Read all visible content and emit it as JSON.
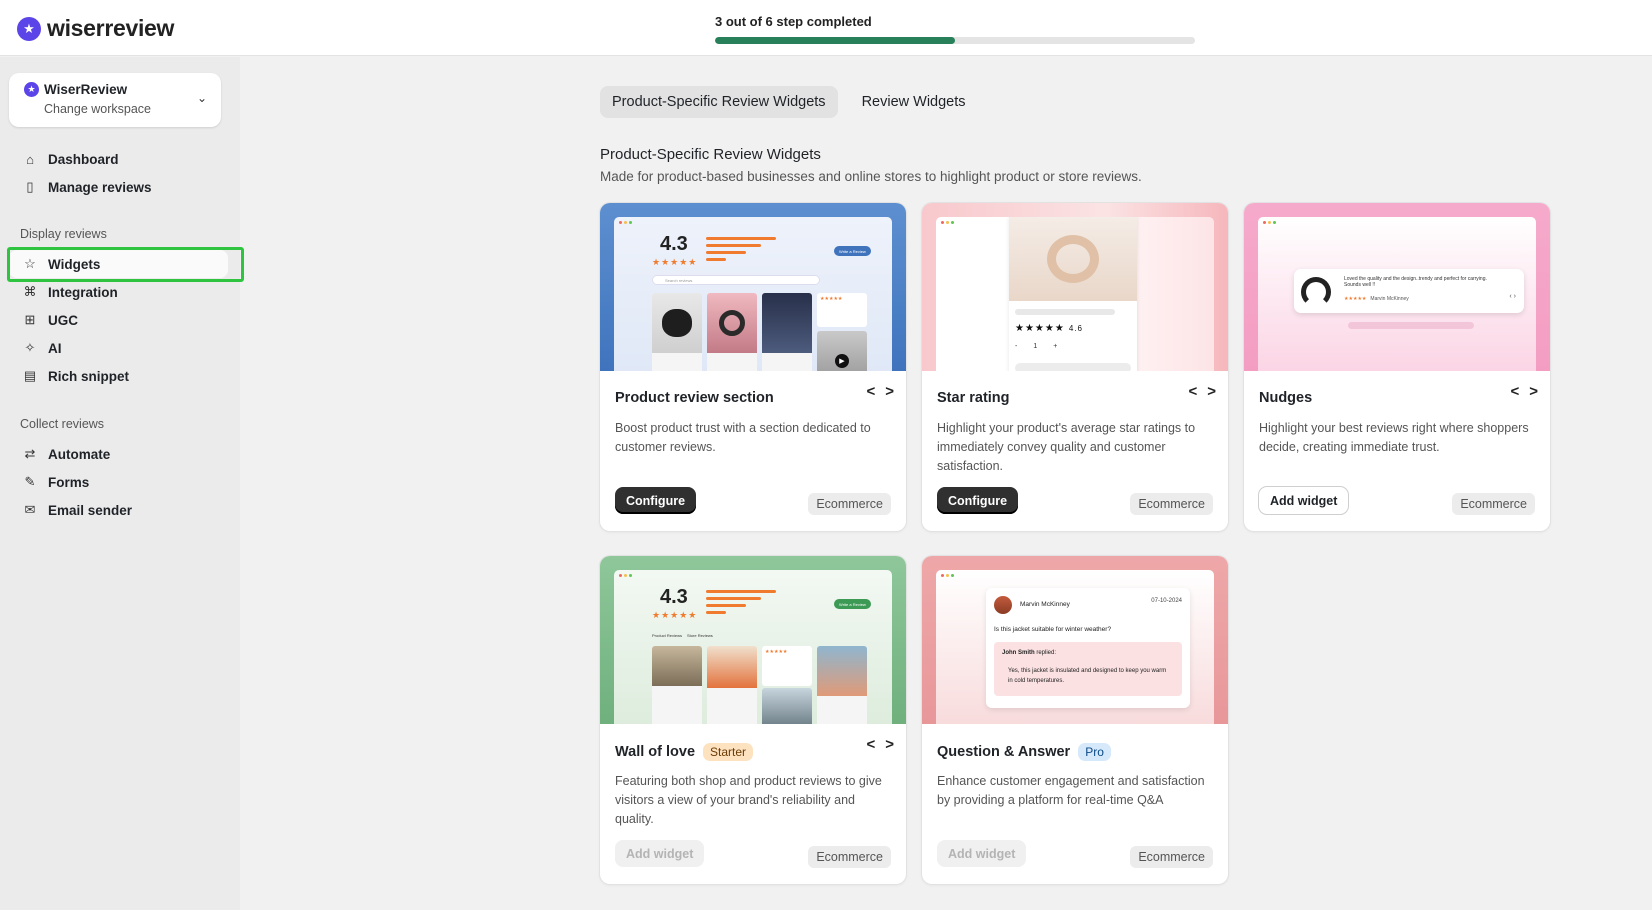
{
  "brand": {
    "name": "wiserreview"
  },
  "progress": {
    "label": "3 out of 6 step completed",
    "fraction": 0.5
  },
  "workspace": {
    "name": "WiserReview",
    "action": "Change workspace"
  },
  "nav": {
    "main": [
      {
        "label": "Dashboard",
        "icon": "home-icon"
      },
      {
        "label": "Manage reviews",
        "icon": "document-icon"
      }
    ],
    "display_heading": "Display reviews",
    "display": [
      {
        "label": "Widgets",
        "icon": "star-icon",
        "active": true
      },
      {
        "label": "Integration",
        "icon": "grid-icon"
      },
      {
        "label": "UGC",
        "icon": "ugc-icon"
      },
      {
        "label": "AI",
        "icon": "sparkle-icon"
      },
      {
        "label": "Rich snippet",
        "icon": "snippet-icon"
      }
    ],
    "collect_heading": "Collect reviews",
    "collect": [
      {
        "label": "Automate",
        "icon": "repeat-icon"
      },
      {
        "label": "Forms",
        "icon": "form-icon"
      },
      {
        "label": "Email sender",
        "icon": "mail-icon"
      }
    ]
  },
  "tabs": [
    {
      "label": "Product-Specific Review Widgets",
      "selected": true
    },
    {
      "label": "Review Widgets",
      "selected": false
    }
  ],
  "section": {
    "title": "Product-Specific Review Widgets",
    "description": "Made for product-based businesses and online stores to highlight product or store reviews."
  },
  "cards": [
    {
      "title": "Product review section",
      "description": "Boost product trust with a section dedicated to customer reviews.",
      "button": "Configure",
      "tag": "Ecommerce",
      "preview": {
        "rating": "4.3",
        "cta": "Write a Review",
        "search": "Search reviews"
      }
    },
    {
      "title": "Star rating",
      "description": "Highlight your product's average star ratings to immediately convey quality and customer satisfaction.",
      "button": "Configure",
      "tag": "Ecommerce",
      "preview": {
        "rating": "4.6",
        "qty": "1",
        "minus": "-",
        "plus": "+"
      }
    },
    {
      "title": "Nudges",
      "description": "Highlight your best reviews right where shoppers decide, creating immediate trust.",
      "button": "Add widget",
      "tag": "Ecommerce",
      "preview": {
        "quote": "Loved the quality and the design..trendy and perfect for carrying. Sounds well !!",
        "author": "Marvin McKinney"
      }
    },
    {
      "title": "Wall of love",
      "badge": "Starter",
      "description": "Featuring both shop and product reviews to give visitors a view of your brand's reliability and quality.",
      "button": "Add widget",
      "tag": "Ecommerce",
      "preview": {
        "rating": "4.3",
        "cta": "Write a Review",
        "tab1": "Product Reviews",
        "tab2": "Store Reviews"
      }
    },
    {
      "title": "Question & Answer",
      "badge": "Pro",
      "description": "Enhance customer engagement and satisfaction by providing a platform for real-time Q&A",
      "button": "Add widget",
      "tag": "Ecommerce",
      "preview": {
        "asker": "Marvin McKinney",
        "date": "07-10-2024",
        "question": "Is this jacket suitable for winter weather?",
        "replier": "John Smith",
        "replied": "replied:",
        "answer": "Yes, this jacket is insulated and designed to keep you warm in cold temperatures."
      }
    }
  ],
  "colors": {
    "accent": "#27805a",
    "brand": "#5b45e8",
    "highlight": "#2ec43f",
    "star": "#f07b2e"
  }
}
